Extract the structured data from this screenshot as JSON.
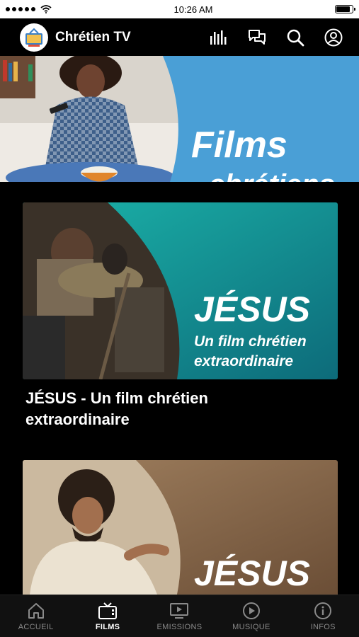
{
  "status_bar": {
    "time": "10:26 AM"
  },
  "header": {
    "title": "Chrétien TV",
    "icons": [
      "audio-bars-icon",
      "chat-icon",
      "search-icon",
      "profile-icon"
    ]
  },
  "hero": {
    "line1": "Films",
    "line2": "chrétiens",
    "accent_color": "#4a9fd6"
  },
  "cards": [
    {
      "thumb_title": "JÉSUS",
      "thumb_sub_line1": "Un film chrétien",
      "thumb_sub_line2": "extraordinaire",
      "caption_line1": "JÉSUS - Un film chrétien",
      "caption_line2": "extraordinaire",
      "accent_color": "#1aa6a0"
    },
    {
      "thumb_title": "JÉSUS",
      "accent_color": "#8a6a4d"
    }
  ],
  "tabs": [
    {
      "label": "ACCUEIL",
      "icon": "home-icon",
      "active": false
    },
    {
      "label": "FILMS",
      "icon": "tv-icon",
      "active": true
    },
    {
      "label": "EMISSIONS",
      "icon": "screen-play-icon",
      "active": false
    },
    {
      "label": "MUSIQUE",
      "icon": "play-circle-icon",
      "active": false
    },
    {
      "label": "INFOS",
      "icon": "info-icon",
      "active": false
    }
  ]
}
